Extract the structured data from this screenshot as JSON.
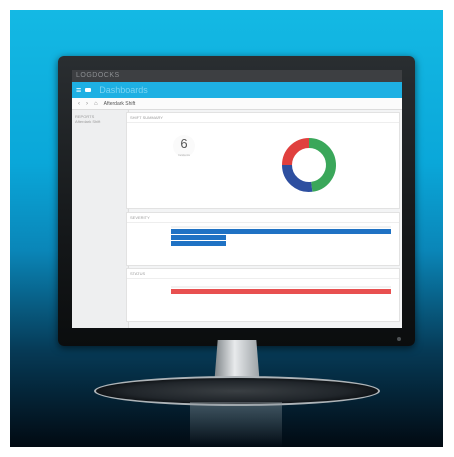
{
  "window": {
    "title": "LOGDOCKS"
  },
  "appbar": {
    "title": "Dashboards"
  },
  "nav": {
    "breadcrumb": "Afterdark Shift"
  },
  "sidebar": {
    "items": [
      "REPORTS",
      "Afterdark Shift"
    ]
  },
  "cards": {
    "summary": {
      "header": "SHIFT SUMMARY",
      "count_value": "6",
      "count_label": "Incidents"
    },
    "severity": {
      "header": "SEVERITY"
    },
    "status": {
      "header": "STATUS"
    }
  },
  "chart_data": [
    {
      "type": "pie",
      "values": [
        48,
        27,
        25
      ],
      "colors": [
        "#3aa75a",
        "#2e4fa0",
        "#e0403e"
      ]
    },
    {
      "type": "bar",
      "categories": [
        "",
        "",
        ""
      ],
      "values": [
        1,
        0.25,
        0.25
      ],
      "color": "#1f72c4"
    },
    {
      "type": "bar",
      "categories": [
        ""
      ],
      "values": [
        1
      ],
      "color": "#e85050"
    }
  ],
  "colors": {
    "accent": "#1eb0e3",
    "bezel": "#1a1d1f"
  },
  "icons": [
    "menu-icon",
    "back-icon",
    "forward-icon",
    "home-icon",
    "power-icon"
  ]
}
